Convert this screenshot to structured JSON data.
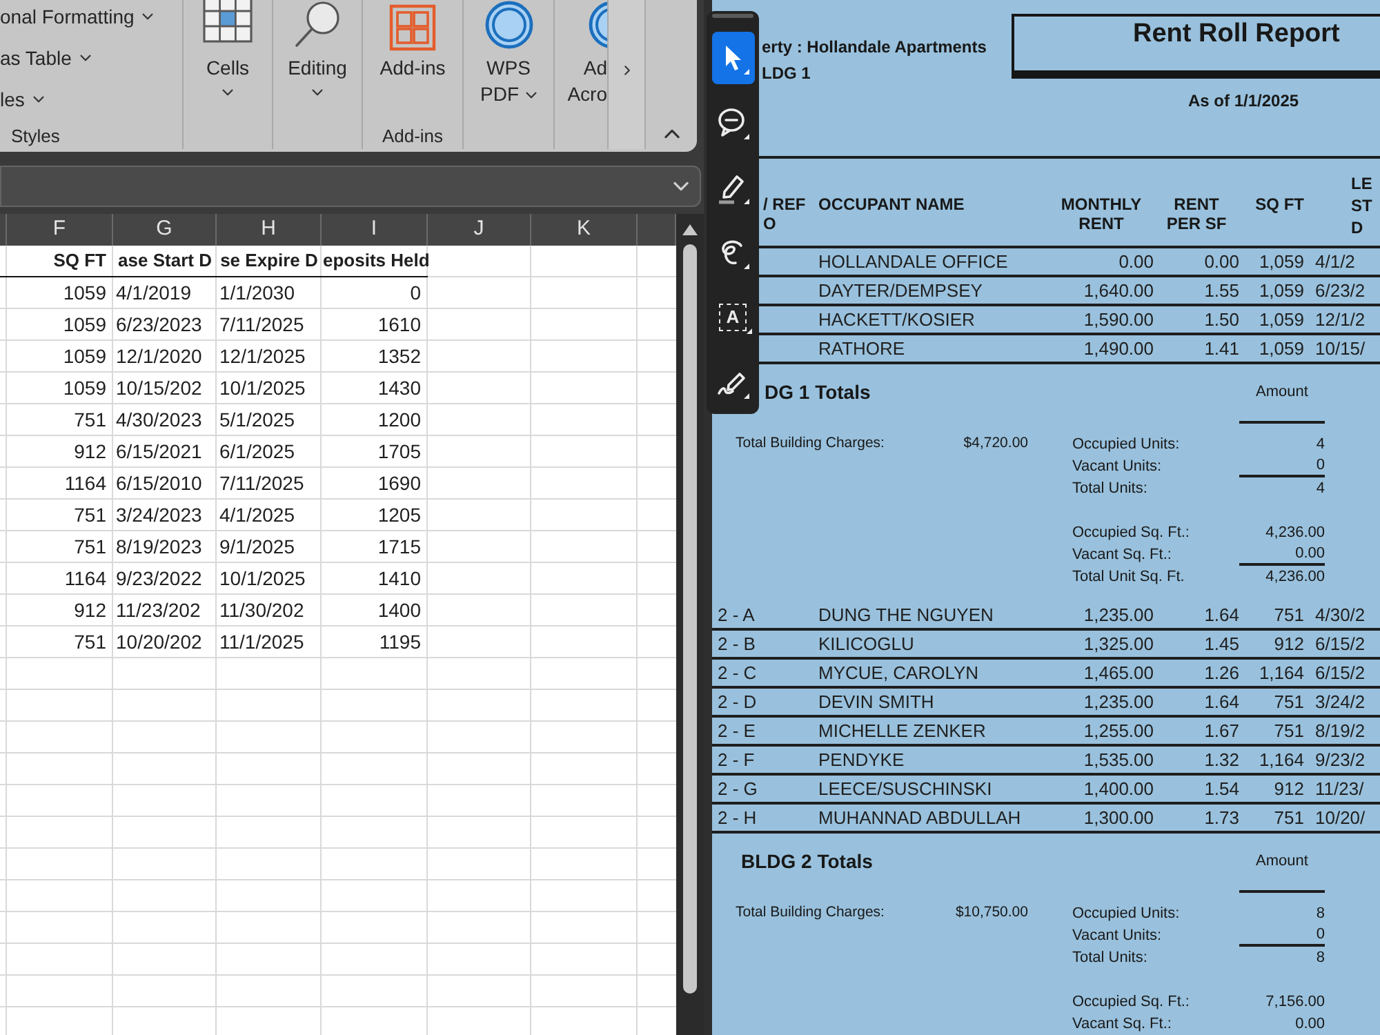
{
  "excel": {
    "ribbon": {
      "groups": [
        {
          "kind": "styles",
          "items": [
            {
              "label": "onal Formatting",
              "dropdown": true
            },
            {
              "label": "as Table",
              "dropdown": true
            },
            {
              "label": "les",
              "dropdown": true
            }
          ],
          "label": "Styles"
        },
        {
          "kind": "cells",
          "lines": [
            "Cells"
          ],
          "dropdown": true
        },
        {
          "kind": "editing",
          "lines": [
            "Editing"
          ],
          "dropdown": true
        },
        {
          "kind": "addins",
          "lines": [
            "Add-ins"
          ],
          "dropdown": false,
          "label": "Add-ins"
        },
        {
          "kind": "wps",
          "lines": [
            "WPS",
            "PDF"
          ],
          "dropdown": true
        },
        {
          "kind": "acrobat",
          "lines": [
            "Ad",
            "Acro"
          ],
          "dropdown": false
        }
      ]
    },
    "sheet": {
      "columns": [
        "F",
        "G",
        "H",
        "I",
        "J",
        "K"
      ],
      "header": [
        "SQ FT",
        "ase Start D",
        "se Expire D",
        "eposits Held"
      ],
      "rows": [
        [
          "1059",
          "4/1/2019",
          "1/1/2030",
          "0"
        ],
        [
          "1059",
          "6/23/2023",
          "7/11/2025",
          "1610"
        ],
        [
          "1059",
          "12/1/2020",
          "12/1/2025",
          "1352"
        ],
        [
          "1059",
          "10/15/202",
          "10/1/2025",
          "1430"
        ],
        [
          "751",
          "4/30/2023",
          "5/1/2025",
          "1200"
        ],
        [
          "912",
          "6/15/2021",
          "6/1/2025",
          "1705"
        ],
        [
          "1164",
          "6/15/2010",
          "7/11/2025",
          "1690"
        ],
        [
          "751",
          "3/24/2023",
          "4/1/2025",
          "1205"
        ],
        [
          "751",
          "8/19/2023",
          "9/1/2025",
          "1715"
        ],
        [
          "1164",
          "9/23/2022",
          "10/1/2025",
          "1410"
        ],
        [
          "912",
          "11/23/202",
          "11/30/202",
          "1400"
        ],
        [
          "751",
          "10/20/202",
          "11/1/2025",
          "1195"
        ]
      ]
    }
  },
  "pdf": {
    "tools": [
      {
        "kind": "select",
        "selected": true
      },
      {
        "kind": "comment",
        "selected": false
      },
      {
        "kind": "highlight",
        "selected": false
      },
      {
        "kind": "lasso",
        "selected": false
      },
      {
        "kind": "text",
        "glyph": "A",
        "selected": false
      },
      {
        "kind": "sign",
        "selected": false
      }
    ],
    "report": {
      "property": "erty : Hollandale Apartments",
      "building": "LDG 1",
      "title": "Rent Roll Report",
      "as_of": "As of 1/1/2025",
      "columns": [
        [
          "/ REF",
          "O"
        ],
        [
          "OCCUPANT NAME"
        ],
        [
          "MONTHLY",
          "RENT"
        ],
        [
          "RENT",
          "PER SF"
        ],
        [
          "SQ FT"
        ],
        [
          "LE",
          "ST",
          "D"
        ]
      ],
      "sections": [
        {
          "rows": [
            {
              "occupant": "HOLLANDALE OFFICE",
              "monthly_rent": "0.00",
              "rent_per_sf": "0.00",
              "sq_ft": "1,059",
              "lease_start": "4/1/2"
            },
            {
              "occupant": "DAYTER/DEMPSEY",
              "monthly_rent": "1,640.00",
              "rent_per_sf": "1.55",
              "sq_ft": "1,059",
              "lease_start": "6/23/2"
            },
            {
              "occupant": "HACKETT/KOSIER",
              "monthly_rent": "1,590.00",
              "rent_per_sf": "1.50",
              "sq_ft": "1,059",
              "lease_start": "12/1/2"
            },
            {
              "occupant": "RATHORE",
              "monthly_rent": "1,490.00",
              "rent_per_sf": "1.41",
              "sq_ft": "1,059",
              "lease_start": "10/15/"
            }
          ],
          "totals": {
            "title": "DG 1 Totals",
            "amount_label": "Amount",
            "charges_label": "Total Building Charges:",
            "charges": "$4,720.00",
            "stats": [
              [
                {
                  "label": "Occupied Units:",
                  "value": "4",
                  "underlined": false
                },
                {
                  "label": "Vacant Units:",
                  "value": "0",
                  "underlined": true
                },
                {
                  "label": "Total Units:",
                  "value": "4",
                  "underlined": false
                }
              ],
              [
                {
                  "label": "Occupied Sq. Ft.:",
                  "value": "4,236.00",
                  "underlined": false
                },
                {
                  "label": "Vacant Sq. Ft.:",
                  "value": "0.00",
                  "underlined": true
                },
                {
                  "label": "Total Unit Sq. Ft.",
                  "value": "4,236.00",
                  "underlined": false
                }
              ]
            ]
          }
        },
        {
          "rows": [
            {
              "unit": "2 - A",
              "occupant": "DUNG THE NGUYEN",
              "monthly_rent": "1,235.00",
              "rent_per_sf": "1.64",
              "sq_ft": "751",
              "lease_start": "4/30/2"
            },
            {
              "unit": "2 - B",
              "occupant": "KILICOGLU",
              "monthly_rent": "1,325.00",
              "rent_per_sf": "1.45",
              "sq_ft": "912",
              "lease_start": "6/15/2"
            },
            {
              "unit": "2 - C",
              "occupant": "MYCUE, CAROLYN",
              "monthly_rent": "1,465.00",
              "rent_per_sf": "1.26",
              "sq_ft": "1,164",
              "lease_start": "6/15/2"
            },
            {
              "unit": "2 - D",
              "occupant": "DEVIN SMITH",
              "monthly_rent": "1,235.00",
              "rent_per_sf": "1.64",
              "sq_ft": "751",
              "lease_start": "3/24/2"
            },
            {
              "unit": "2 - E",
              "occupant": "MICHELLE ZENKER",
              "monthly_rent": "1,255.00",
              "rent_per_sf": "1.67",
              "sq_ft": "751",
              "lease_start": "8/19/2"
            },
            {
              "unit": "2 - F",
              "occupant": "PENDYKE",
              "monthly_rent": "1,535.00",
              "rent_per_sf": "1.32",
              "sq_ft": "1,164",
              "lease_start": "9/23/2"
            },
            {
              "unit": "2 - G",
              "occupant": "LEECE/SUSCHINSKI",
              "monthly_rent": "1,400.00",
              "rent_per_sf": "1.54",
              "sq_ft": "912",
              "lease_start": "11/23/"
            },
            {
              "unit": "2 - H",
              "occupant": "MUHANNAD ABDULLAH",
              "monthly_rent": "1,300.00",
              "rent_per_sf": "1.73",
              "sq_ft": "751",
              "lease_start": "10/20/"
            }
          ],
          "totals": {
            "title": "BLDG 2 Totals",
            "amount_label": "Amount",
            "charges_label": "Total Building Charges:",
            "charges": "$10,750.00",
            "stats": [
              [
                {
                  "label": "Occupied Units:",
                  "value": "8",
                  "underlined": false
                },
                {
                  "label": "Vacant Units:",
                  "value": "0",
                  "underlined": true
                },
                {
                  "label": "Total Units:",
                  "value": "8",
                  "underlined": false
                }
              ],
              [
                {
                  "label": "Occupied Sq. Ft.:",
                  "value": "7,156.00",
                  "underlined": false
                },
                {
                  "label": "Vacant Sq. Ft.:",
                  "value": "0.00",
                  "underlined": false
                }
              ]
            ]
          }
        }
      ]
    }
  }
}
